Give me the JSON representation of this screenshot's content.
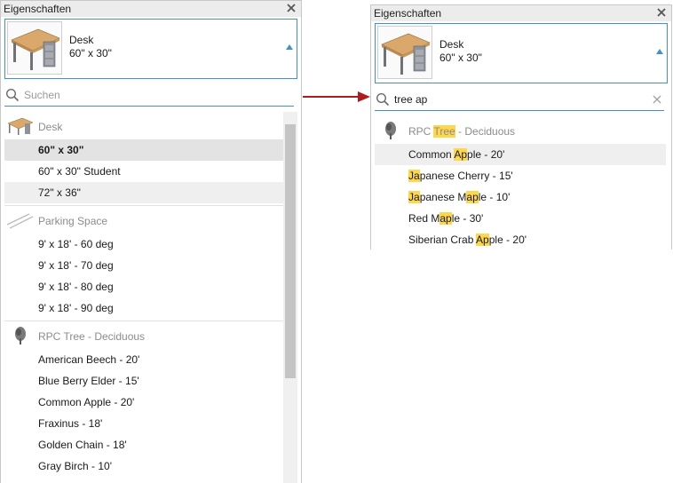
{
  "left_panel": {
    "title": "Eigenschaften",
    "type_name": "Desk",
    "type_dims": "60\" x 30\"",
    "search_placeholder": "Suchen",
    "groups": [
      {
        "label": "Desk",
        "icon": "desk-icon",
        "items": [
          {
            "label": "60\" x 30\"",
            "state": "selected"
          },
          {
            "label": "60\" x 30\" Student",
            "state": ""
          },
          {
            "label": "72\" x 36\"",
            "state": "hover"
          }
        ]
      },
      {
        "label": "Parking Space",
        "icon": "parking-space-icon",
        "items": [
          {
            "label": "9' x 18' - 60 deg"
          },
          {
            "label": "9' x 18' - 70 deg"
          },
          {
            "label": "9' x 18' - 80 deg"
          },
          {
            "label": "9' x 18' - 90 deg"
          }
        ]
      },
      {
        "label": "RPC Tree - Deciduous",
        "icon": "tree-icon",
        "items": [
          {
            "label": "American Beech - 20'"
          },
          {
            "label": "Blue Berry Elder - 15'"
          },
          {
            "label": "Common Apple - 20'"
          },
          {
            "label": "Fraxinus - 18'"
          },
          {
            "label": "Golden Chain - 18'"
          },
          {
            "label": "Gray Birch - 10'"
          }
        ]
      }
    ]
  },
  "right_panel": {
    "title": "Eigenschaften",
    "type_name": "Desk",
    "type_dims": "60\" x 30\"",
    "search_value": "tree ap",
    "group": {
      "label_before": "RPC ",
      "label_match": "Tree",
      "label_after": " - Deciduous"
    },
    "items": [
      {
        "parts": [
          "Common ",
          "Ap",
          "ple - 20'"
        ],
        "state": "hover"
      },
      {
        "parts": [
          "",
          "Ja",
          "panese Cherry - 15'"
        ]
      },
      {
        "parts": [
          "",
          "Ja",
          "panese M",
          "ap",
          "le - 10'"
        ]
      },
      {
        "parts": [
          "Red M",
          "ap",
          "le - 30'"
        ]
      },
      {
        "parts": [
          "Siberian Crab ",
          "Ap",
          "ple - 20'"
        ]
      }
    ]
  },
  "colors": {
    "accent": "#3f93c9",
    "highlight": "#ffd84a",
    "arrow": "#b01c1c"
  }
}
